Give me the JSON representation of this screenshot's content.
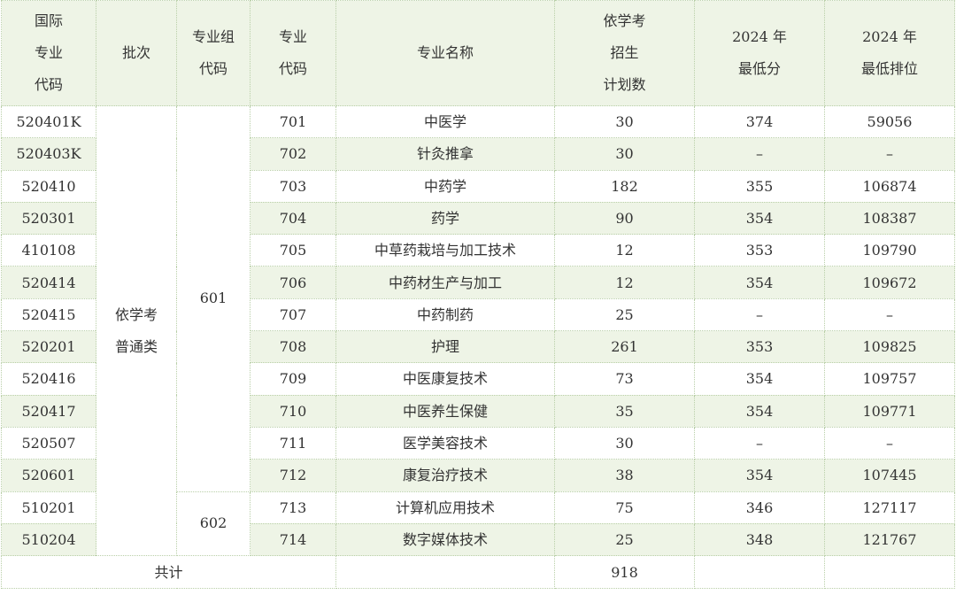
{
  "table": {
    "headers": [
      "国际\n专业\n代码",
      "批次",
      "专业组\n代码",
      "专业\n代码",
      "专业名称",
      "依学考\n招生\n计划数",
      "2024 年\n最低分",
      "2024 年\n最低排位"
    ],
    "batch": "依学考\n普通类",
    "groups": [
      {
        "code": "601",
        "rows": 12
      },
      {
        "code": "602",
        "rows": 2
      }
    ],
    "rows": [
      {
        "intl": "520401K",
        "code": "701",
        "name": "中医学",
        "plan": "30",
        "score": "374",
        "rank": "59056"
      },
      {
        "intl": "520403K",
        "code": "702",
        "name": "针灸推拿",
        "plan": "30",
        "score": "–",
        "rank": "–"
      },
      {
        "intl": "520410",
        "code": "703",
        "name": "中药学",
        "plan": "182",
        "score": "355",
        "rank": "106874"
      },
      {
        "intl": "520301",
        "code": "704",
        "name": "药学",
        "plan": "90",
        "score": "354",
        "rank": "108387"
      },
      {
        "intl": "410108",
        "code": "705",
        "name": "中草药栽培与加工技术",
        "plan": "12",
        "score": "353",
        "rank": "109790"
      },
      {
        "intl": "520414",
        "code": "706",
        "name": "中药材生产与加工",
        "plan": "12",
        "score": "354",
        "rank": "109672"
      },
      {
        "intl": "520415",
        "code": "707",
        "name": "中药制药",
        "plan": "25",
        "score": "–",
        "rank": "–"
      },
      {
        "intl": "520201",
        "code": "708",
        "name": "护理",
        "plan": "261",
        "score": "353",
        "rank": "109825"
      },
      {
        "intl": "520416",
        "code": "709",
        "name": "中医康复技术",
        "plan": "73",
        "score": "354",
        "rank": "109757"
      },
      {
        "intl": "520417",
        "code": "710",
        "name": "中医养生保健",
        "plan": "35",
        "score": "354",
        "rank": "109771"
      },
      {
        "intl": "520507",
        "code": "711",
        "name": "医学美容技术",
        "plan": "30",
        "score": "–",
        "rank": "–"
      },
      {
        "intl": "520601",
        "code": "712",
        "name": "康复治疗技术",
        "plan": "38",
        "score": "354",
        "rank": "107445"
      },
      {
        "intl": "510201",
        "code": "713",
        "name": "计算机应用技术",
        "plan": "75",
        "score": "346",
        "rank": "127117"
      },
      {
        "intl": "510204",
        "code": "714",
        "name": "数字媒体技术",
        "plan": "25",
        "score": "348",
        "rank": "121767"
      }
    ],
    "total": {
      "label": "共计",
      "plan": "918",
      "score": "",
      "rank": ""
    }
  }
}
